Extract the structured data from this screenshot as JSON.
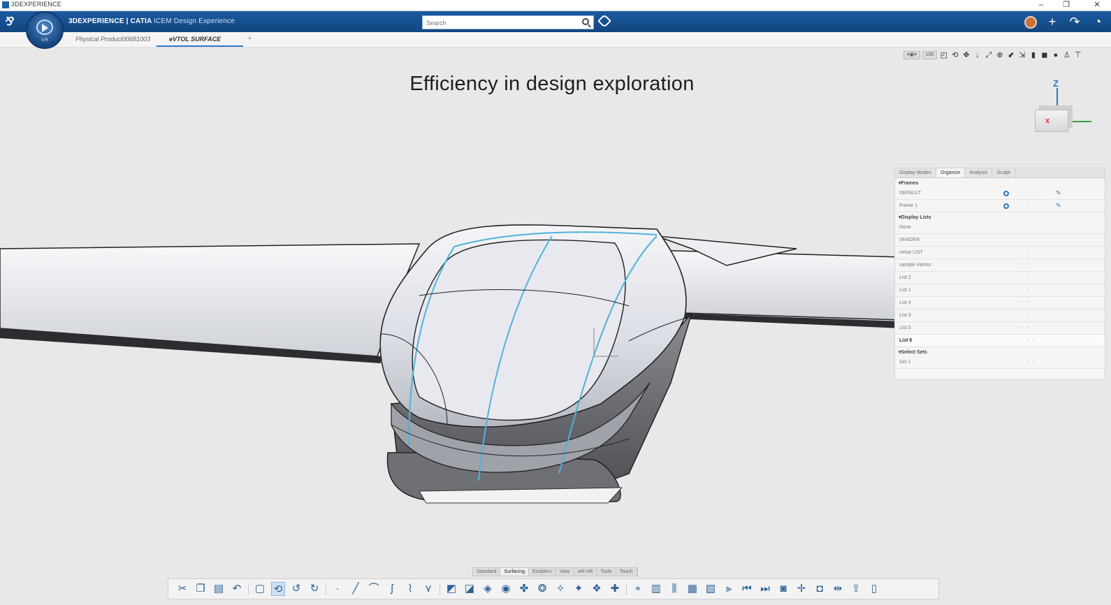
{
  "window": {
    "title": "3DEXPERIENCE",
    "controls": {
      "minimize": "–",
      "maximize": "❐",
      "close": "✕"
    }
  },
  "topbar": {
    "brand_bold": "3DEXPERIENCE | CATIA",
    "brand_thin": "ICEM Design Experience",
    "compass_version": "V.R",
    "search_placeholder": "Search",
    "right_icons": [
      "user-avatar",
      "plus-icon",
      "share-icon",
      "help-icon"
    ]
  },
  "tabs": [
    {
      "label": "Physical Product00681003",
      "active": false
    },
    {
      "label": "eVTOL SURFACE",
      "active": true
    }
  ],
  "tab_add": "+",
  "viewport": {
    "headline": "Efficiency in design exploration",
    "zoom_pill": "100",
    "axis_z": "Z",
    "axis_x_mark": "x"
  },
  "panel": {
    "tabs": [
      {
        "label": "Display Modes",
        "active": false
      },
      {
        "label": "Organize",
        "active": true
      },
      {
        "label": "Analysis",
        "active": false
      },
      {
        "label": "Sculpt",
        "active": false
      }
    ],
    "frames_header": "▾Frames",
    "frames": [
      {
        "label": "DEFAULT"
      },
      {
        "label": "Frame 1"
      }
    ],
    "display_lists_header": "▾Display Lists",
    "display_lists": [
      {
        "label": "None",
        "bold": false
      },
      {
        "label": "SHADER",
        "bold": false
      },
      {
        "label": "setup LIST",
        "bold": false
      },
      {
        "label": "sample interior",
        "bold": false
      },
      {
        "label": "List 2",
        "bold": false
      },
      {
        "label": "List 1",
        "bold": false
      },
      {
        "label": "List 4",
        "bold": false
      },
      {
        "label": "List 3",
        "bold": false
      },
      {
        "label": "List 5",
        "bold": false
      },
      {
        "label": "List 6",
        "bold": true
      }
    ],
    "select_sets_header": "▾Select Sets",
    "select_sets": [
      {
        "label": "Set 1"
      }
    ]
  },
  "action_tabs": [
    {
      "label": "Standard",
      "active": false
    },
    {
      "label": "Surfacing",
      "active": true
    },
    {
      "label": "Enablers",
      "active": false
    },
    {
      "label": "View",
      "active": false
    },
    {
      "label": "AR-VR",
      "active": false
    },
    {
      "label": "Tools",
      "active": false
    },
    {
      "label": "Touch",
      "active": false
    }
  ],
  "colors": {
    "brand_blue": "#1a5aa0",
    "accent": "#2a7ac4",
    "curve_highlight": "#4fb3d9",
    "viewport_bg": "#e8e8e8"
  }
}
